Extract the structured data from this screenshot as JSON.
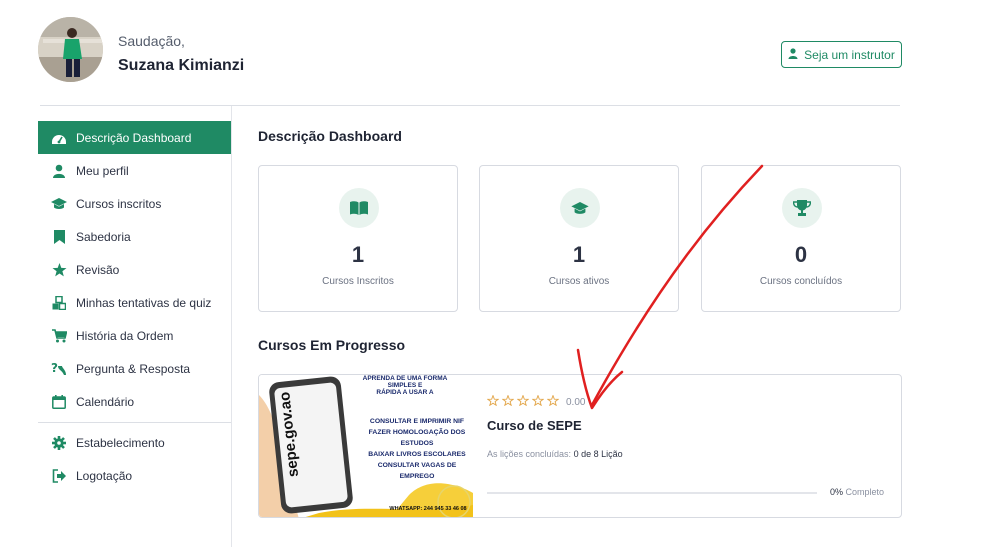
{
  "header": {
    "greeting": "Saudação,",
    "user_name": "Suzana Kimianzi",
    "instructor_button": "Seja um instrutor"
  },
  "sidebar": {
    "items": [
      {
        "label": "Descrição Dashboard",
        "icon": "dashboard-icon",
        "active": true
      },
      {
        "label": "Meu perfil",
        "icon": "user-icon"
      },
      {
        "label": "Cursos inscritos",
        "icon": "graduation-cap-icon"
      },
      {
        "label": "Sabedoria",
        "icon": "bookmark-icon"
      },
      {
        "label": "Revisão",
        "icon": "star-icon"
      },
      {
        "label": "Minhas tentativas de quiz",
        "icon": "cubes-icon"
      },
      {
        "label": "História da Ordem",
        "icon": "cart-icon"
      },
      {
        "label": "Pergunta & Resposta",
        "icon": "question-icon"
      },
      {
        "label": "Calendário",
        "icon": "calendar-icon"
      }
    ],
    "bottom_items": [
      {
        "label": "Estabelecimento",
        "icon": "gear-icon"
      },
      {
        "label": "Logotação",
        "icon": "logout-icon"
      }
    ]
  },
  "main": {
    "dashboard_title": "Descrição Dashboard",
    "stats": [
      {
        "value": "1",
        "label": "Cursos Inscritos",
        "icon": "book-open-icon"
      },
      {
        "value": "1",
        "label": "Cursos ativos",
        "icon": "graduation-cap-icon"
      },
      {
        "value": "0",
        "label": "Cursos concluídos",
        "icon": "trophy-icon"
      }
    ],
    "in_progress_title": "Cursos Em Progresso",
    "course": {
      "rating": "0.00",
      "stars_filled": 0,
      "title": "Curso de SEPE",
      "lessons_label": "As lições concluídas:",
      "lessons_value": "0 de 8 Lição",
      "progress_percent": 0,
      "progress_value": "0%",
      "progress_suffix": "Completo",
      "thumb": {
        "line1": "APRENDA DE UMA FORMA SIMPLES E",
        "line2": "RÁPIDA A USAR A",
        "items": [
          "CONSULTAR E IMPRIMIR NIF",
          "FAZER HOMOLOGAÇÃO DOS ESTUDOS",
          "BAIXAR LIVROS ESCOLARES",
          "CONSULTAR VAGAS DE EMPREGO"
        ],
        "phone_brand": "sepe.gov.ao",
        "whatsapp": "WHATSAPP: 244 945 33 46 08"
      }
    }
  },
  "colors": {
    "accent": "#1f8a64",
    "annotation": "#e02020",
    "star": "#e3a74b"
  }
}
